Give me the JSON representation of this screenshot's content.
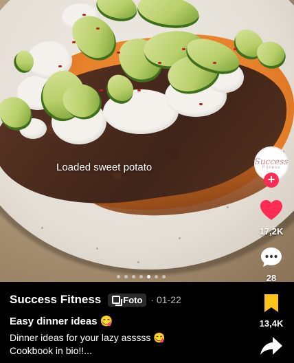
{
  "photo": {
    "overlay_caption": "Loaded sweet potato"
  },
  "profile": {
    "avatar_text": "Success",
    "avatar_sub": "Fitness"
  },
  "actions": {
    "follow_symbol": "+",
    "likes": "17,2K",
    "comments": "28",
    "saves": "13,4K"
  },
  "carousel": {
    "total": 7,
    "active_index": 4
  },
  "post": {
    "author": "Success Fitness",
    "type_label": "Foto",
    "date": "· 01-22",
    "title": "Easy dinner ideas 😋",
    "description_line1": "Dinner ideas for your lazy asssss 😋",
    "description_line2": "Cookbook in bio!!..."
  },
  "colors": {
    "like_red": "#fe2c55",
    "save_yellow": "#fcc419",
    "background": "#000000"
  },
  "icons": [
    "heart-icon",
    "comment-icon",
    "bookmark-icon",
    "share-icon",
    "photo-icon",
    "plus-icon"
  ]
}
